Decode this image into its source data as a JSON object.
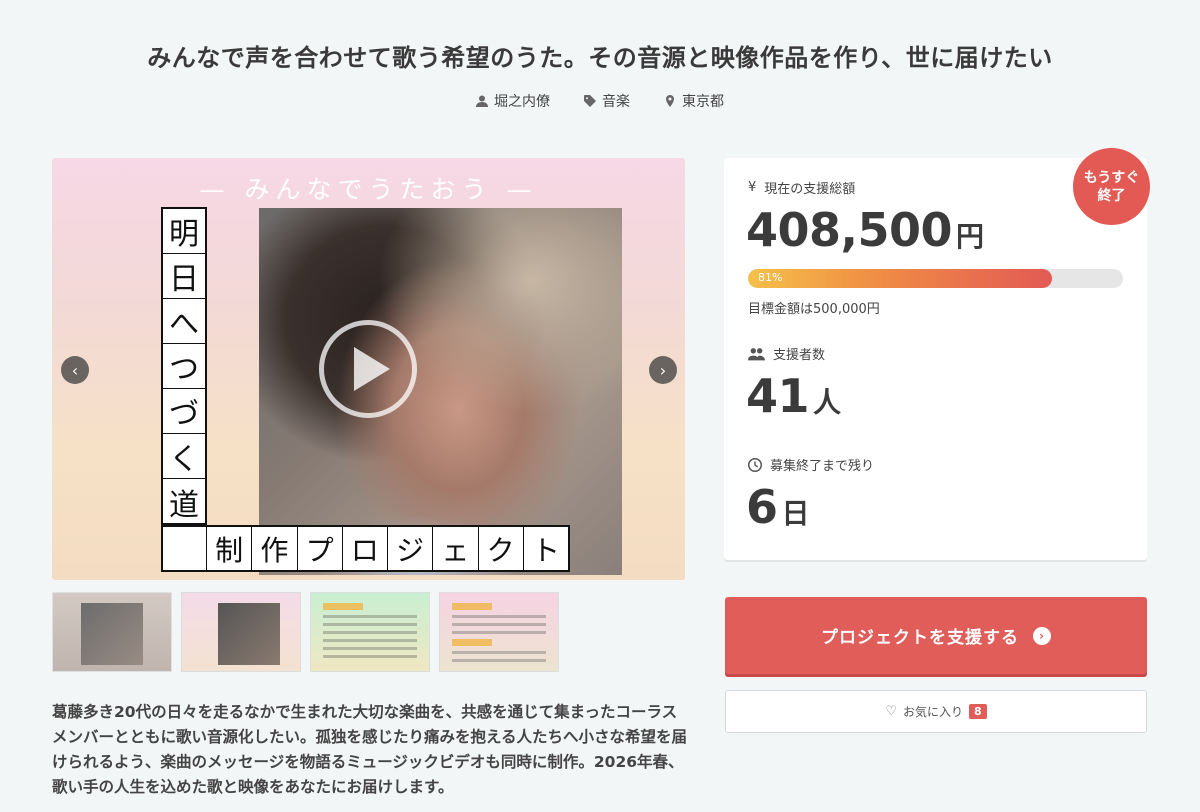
{
  "project": {
    "title": "みんなで声を合わせて歌う希望のうた。その音源と映像作品を作り、世に届けたい",
    "owner": "堀之内僚",
    "category": "音楽",
    "location": "東京都"
  },
  "visual": {
    "subtitle": "— みんなでうたおう —",
    "vertical_title": [
      "明",
      "日",
      "へ",
      "つ",
      "づ",
      "く",
      "道"
    ],
    "horizontal_title": [
      "制",
      "作",
      "プ",
      "ロ",
      "ジ",
      "ェ",
      "ク",
      "ト"
    ]
  },
  "description": "葛藤多き20代の日々を走るなかで生まれた大切な楽曲を、共感を通じて集まったコーラスメンバーとともに歌い音源化したい。孤独を感じたり痛みを抱える人たちへ小さな希望を届けられるよう、楽曲のメッセージを物語るミュージックビデオも同時に制作。2026年春、歌い手の人生を込めた歌と映像をあなたにお届けします。",
  "stats": {
    "badge_line1": "もうすぐ",
    "badge_line2": "終了",
    "amount_label": "現在の支援総額",
    "amount_value": "408,500",
    "amount_unit": "円",
    "progress_percent": 81,
    "progress_label": "81%",
    "goal_text": "目標金額は500,000円",
    "backers_label": "支援者数",
    "backers_value": "41",
    "backers_unit": "人",
    "remaining_label": "募集終了まで残り",
    "remaining_value": "6",
    "remaining_unit": "日"
  },
  "actions": {
    "support_label": "プロジェクトを支援する",
    "favorite_label": "お気に入り",
    "favorite_count": "8"
  },
  "colors": {
    "accent": "#e05d5a",
    "background": "#f2f6f7"
  }
}
